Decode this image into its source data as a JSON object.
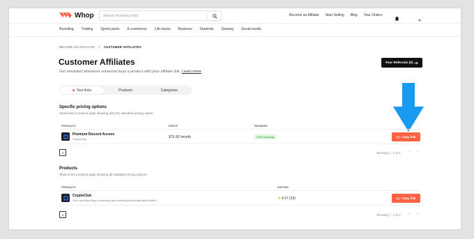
{
  "colors": {
    "accent": "#ff6243",
    "dark": "#111111",
    "arrow": "#1a9bf0",
    "badge_bg": "#dff5dc",
    "badge_text": "#2e8a2a"
  },
  "header": {
    "logo_text": "Whop",
    "search_placeholder": "Search 'investing tools'",
    "nav": [
      "Become an Affiliate",
      "Start Selling",
      "Blog",
      "Your Orders"
    ]
  },
  "categories": [
    "Reselling",
    "Trading",
    "Sports picks",
    "E-commerce",
    "Life hacks",
    "Business",
    "Students",
    "Gaming",
    "Social media"
  ],
  "breadcrumb": {
    "parent": "BECOME AN AFFILIATE",
    "separator": ">",
    "current": "CUSTOMER AFFILIATES"
  },
  "page": {
    "title": "Customer Affiliates",
    "subtitle": "Get rewarded whenever someone buys a product with your affiliate link.",
    "learn_more": "Learn more",
    "referrals_button": "Your Referrals (0)"
  },
  "tabs": [
    {
      "label": "Your links",
      "active": true
    },
    {
      "label": "Products",
      "active": false
    },
    {
      "label": "Categories",
      "active": false
    }
  ],
  "specific": {
    "title": "Specific pricing options",
    "subtitle": "Share link to product page showing only the specified pricing option.",
    "headers": {
      "product": "PRODUCT",
      "price": "PRICE",
      "reward": "REWARD"
    },
    "rows": [
      {
        "name": "Premium Discord Access",
        "seller": "CryptoClub",
        "price": "$75.00 /month",
        "reward": "30% recurring",
        "action": "Copy link"
      }
    ],
    "page": "1",
    "showing": "Showing 1 - 1 of 1"
  },
  "products": {
    "title": "Products",
    "subtitle": "Share link to product page showing all available pricing options.",
    "headers": {
      "product": "PRODUCT",
      "rating": "RATING"
    },
    "rows": [
      {
        "name": "CryptoClub",
        "desc": "Your one-stop shop to learning and excelling financially within Web3.",
        "rating": "4.97 (33)",
        "action": "Copy link"
      }
    ],
    "page": "1",
    "showing": "Showing 1 - 1 of 1"
  }
}
